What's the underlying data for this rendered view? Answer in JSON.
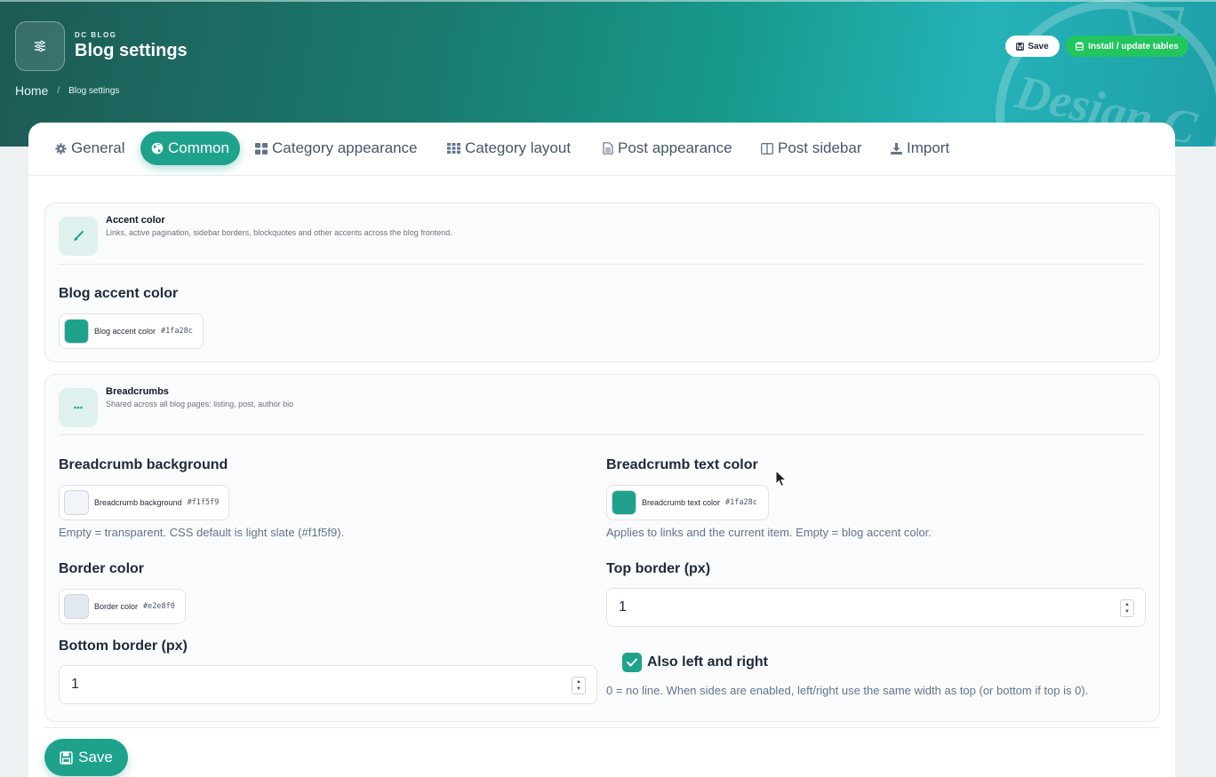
{
  "header": {
    "kicker": "DC BLOG",
    "title": "Blog settings",
    "breadcrumb": {
      "home": "Home",
      "separator": "/",
      "current": "Blog settings"
    },
    "save_label": "Save",
    "install_label": "Install / update tables",
    "icon": "sliders-icon"
  },
  "tabs": [
    {
      "label": "General",
      "icon": "gear-icon",
      "active": false
    },
    {
      "label": "Common",
      "icon": "globe-icon",
      "active": true
    },
    {
      "label": "Category appearance",
      "icon": "grid-2x2-icon",
      "active": false
    },
    {
      "label": "Category layout",
      "icon": "grid-3x3-icon",
      "active": false
    },
    {
      "label": "Post appearance",
      "icon": "document-icon",
      "active": false
    },
    {
      "label": "Post sidebar",
      "icon": "columns-icon",
      "active": false
    },
    {
      "label": "Import",
      "icon": "download-icon",
      "active": false
    }
  ],
  "accent": {
    "title": "Accent color",
    "description": "Links, active pagination, sidebar borders, blockquotes and other accents across the blog frontend.",
    "icon": "paintbrush-icon",
    "field_label": "Blog accent color",
    "swatch_name": "Blog accent color",
    "swatch_hex": "#1fa28c",
    "color": "#1fa28c"
  },
  "breadcrumbs": {
    "title": "Breadcrumbs",
    "description": "Shared across all blog pages: listing, post, author bio",
    "icon": "ellipsis-icon",
    "background": {
      "label": "Breadcrumb background",
      "swatch_name": "Breadcrumb background",
      "swatch_hex": "#f1f5f9",
      "color": "#f1f5f9",
      "help": "Empty = transparent. CSS default is light slate (#f1f5f9)."
    },
    "text_color": {
      "label": "Breadcrumb text color",
      "swatch_name": "Breadcrumb text color",
      "swatch_hex": "#1fa28c",
      "color": "#1fa28c",
      "help": "Applies to links and the current item. Empty = blog accent color."
    },
    "border_color": {
      "label": "Border color",
      "swatch_name": "Border color",
      "swatch_hex": "#e2e8f0",
      "color": "#e2e8f0"
    },
    "top_border": {
      "label": "Top border (px)",
      "value": "1"
    },
    "bottom_border": {
      "label": "Bottom border (px)",
      "value": "1"
    },
    "sides": {
      "label": "Also left and right",
      "checked": true,
      "help": "0 = no line. When sides are enabled, left/right use the same width as top (or bottom if top is 0)."
    }
  },
  "footer": {
    "save_label": "Save"
  }
}
